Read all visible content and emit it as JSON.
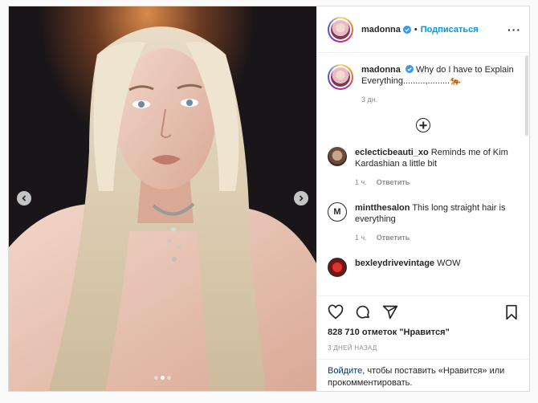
{
  "post": {
    "username": "madonna",
    "follow_label": "Подписаться",
    "separator": "•",
    "more_label": "···"
  },
  "caption": {
    "username": "madonna",
    "text": "Why do I have to Explain Everything.........,.........🐅",
    "time": "3 дн."
  },
  "comments": [
    {
      "username": "eclecticbeauti_xo",
      "text": "Reminds me of Kim Kardashian a little bit",
      "time": "1 ч.",
      "reply": "Ответить"
    },
    {
      "username": "mintthesalon",
      "text": "This long straight hair is everything",
      "time": "1 ч.",
      "reply": "Ответить",
      "avatar_letter": "M"
    },
    {
      "username": "bexleydrivevintage",
      "text": "WOW"
    }
  ],
  "likes": "828 710 отметок \"Нравится\"",
  "date": "3 дней назад",
  "login": {
    "link": "Войдите",
    "text": ", чтобы поставить «Нравится» или прокомментировать."
  },
  "media": {
    "slide_count": 3,
    "active_slide": 2
  },
  "colors": {
    "accent": "#0095f6",
    "verified": "#3897f0",
    "muted": "#8e8e8e"
  }
}
